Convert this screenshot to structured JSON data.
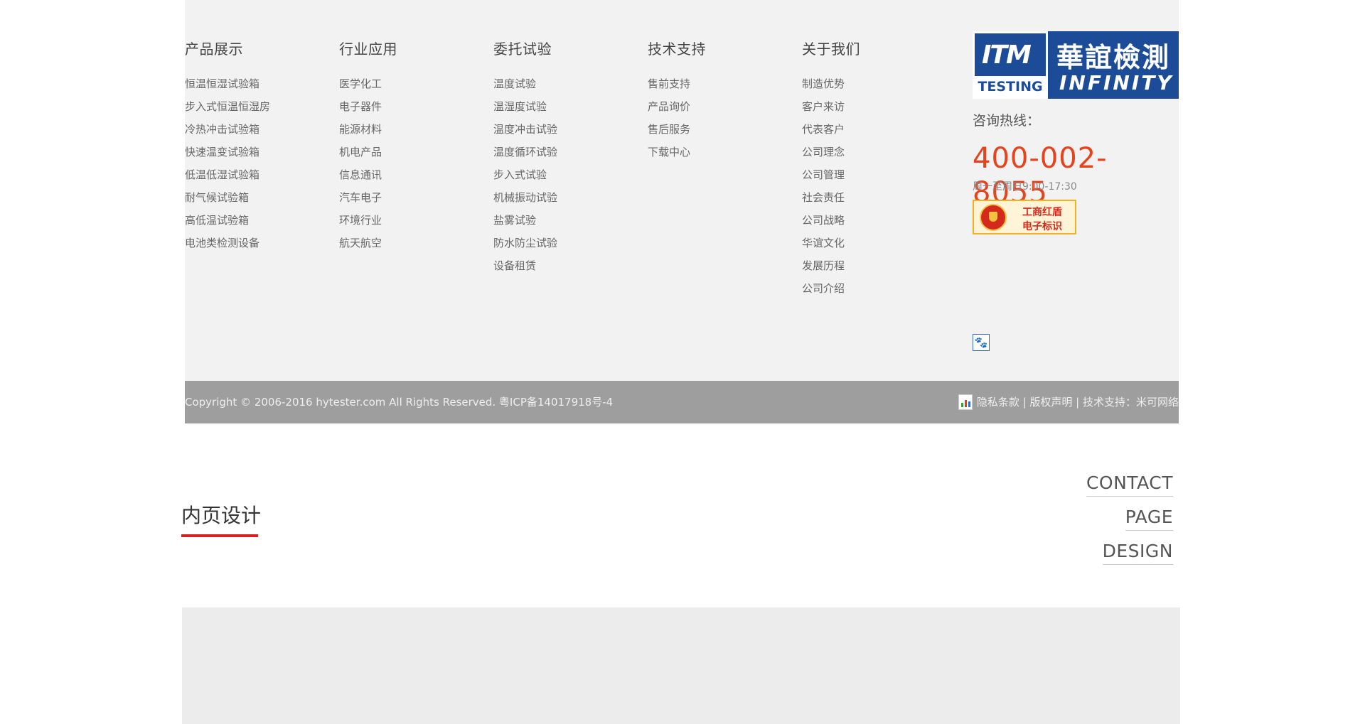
{
  "columns": [
    {
      "heading": "产品展示",
      "items": [
        "恒温恒湿试验箱",
        "步入式恒温恒湿房",
        "冷热冲击试验箱",
        "快速温变试验箱",
        "低温低湿试验箱",
        "耐气候试验箱",
        "高低温试验箱",
        "电池类检测设备"
      ]
    },
    {
      "heading": "行业应用",
      "items": [
        "医学化工",
        "电子器件",
        "能源材料",
        "机电产品",
        "信息通讯",
        "汽车电子",
        "环境行业",
        "航天航空"
      ]
    },
    {
      "heading": "委托试验",
      "items": [
        "温度试验",
        "温湿度试验",
        "温度冲击试验",
        "温度循环试验",
        "步入式试验",
        "机械振动试验",
        "盐雾试验",
        "防水防尘试验",
        "设备租赁"
      ]
    },
    {
      "heading": "技术支持",
      "items": [
        "售前支持",
        "产品询价",
        "售后服务",
        "下载中心"
      ]
    },
    {
      "heading": "关于我们",
      "items": [
        "制造优势",
        "客户来访",
        "代表客户",
        "公司理念",
        "公司管理",
        "社会责任",
        "公司战略",
        "华谊文化",
        "发展历程",
        "公司介绍"
      ]
    }
  ],
  "logo": {
    "mark": "ITM",
    "testing": "TESTING",
    "cn_name": "華誼檢測",
    "en_name": "INFINITY"
  },
  "contact": {
    "hotline_label": "咨询热线：",
    "phone": "400-002-8055",
    "hours": "周一至周日9:00-17:30"
  },
  "badge": {
    "line1": "工商红盾",
    "line2": "电子标识"
  },
  "copyright": {
    "text": "Copyright © 2006-2016 hytester.com All Rights Reserved. 粤ICP备14017918号-4",
    "links": "隐私条款 | 版权声明 | 技术支持：米可网络"
  },
  "section": {
    "title": "内页设计",
    "en_lines": [
      "CONTACT",
      "PAGE",
      "DESIGN"
    ]
  },
  "colors": {
    "accent_red": "#d81e1e",
    "phone_orange": "#e8421c",
    "logo_blue": "#1c4b97"
  }
}
